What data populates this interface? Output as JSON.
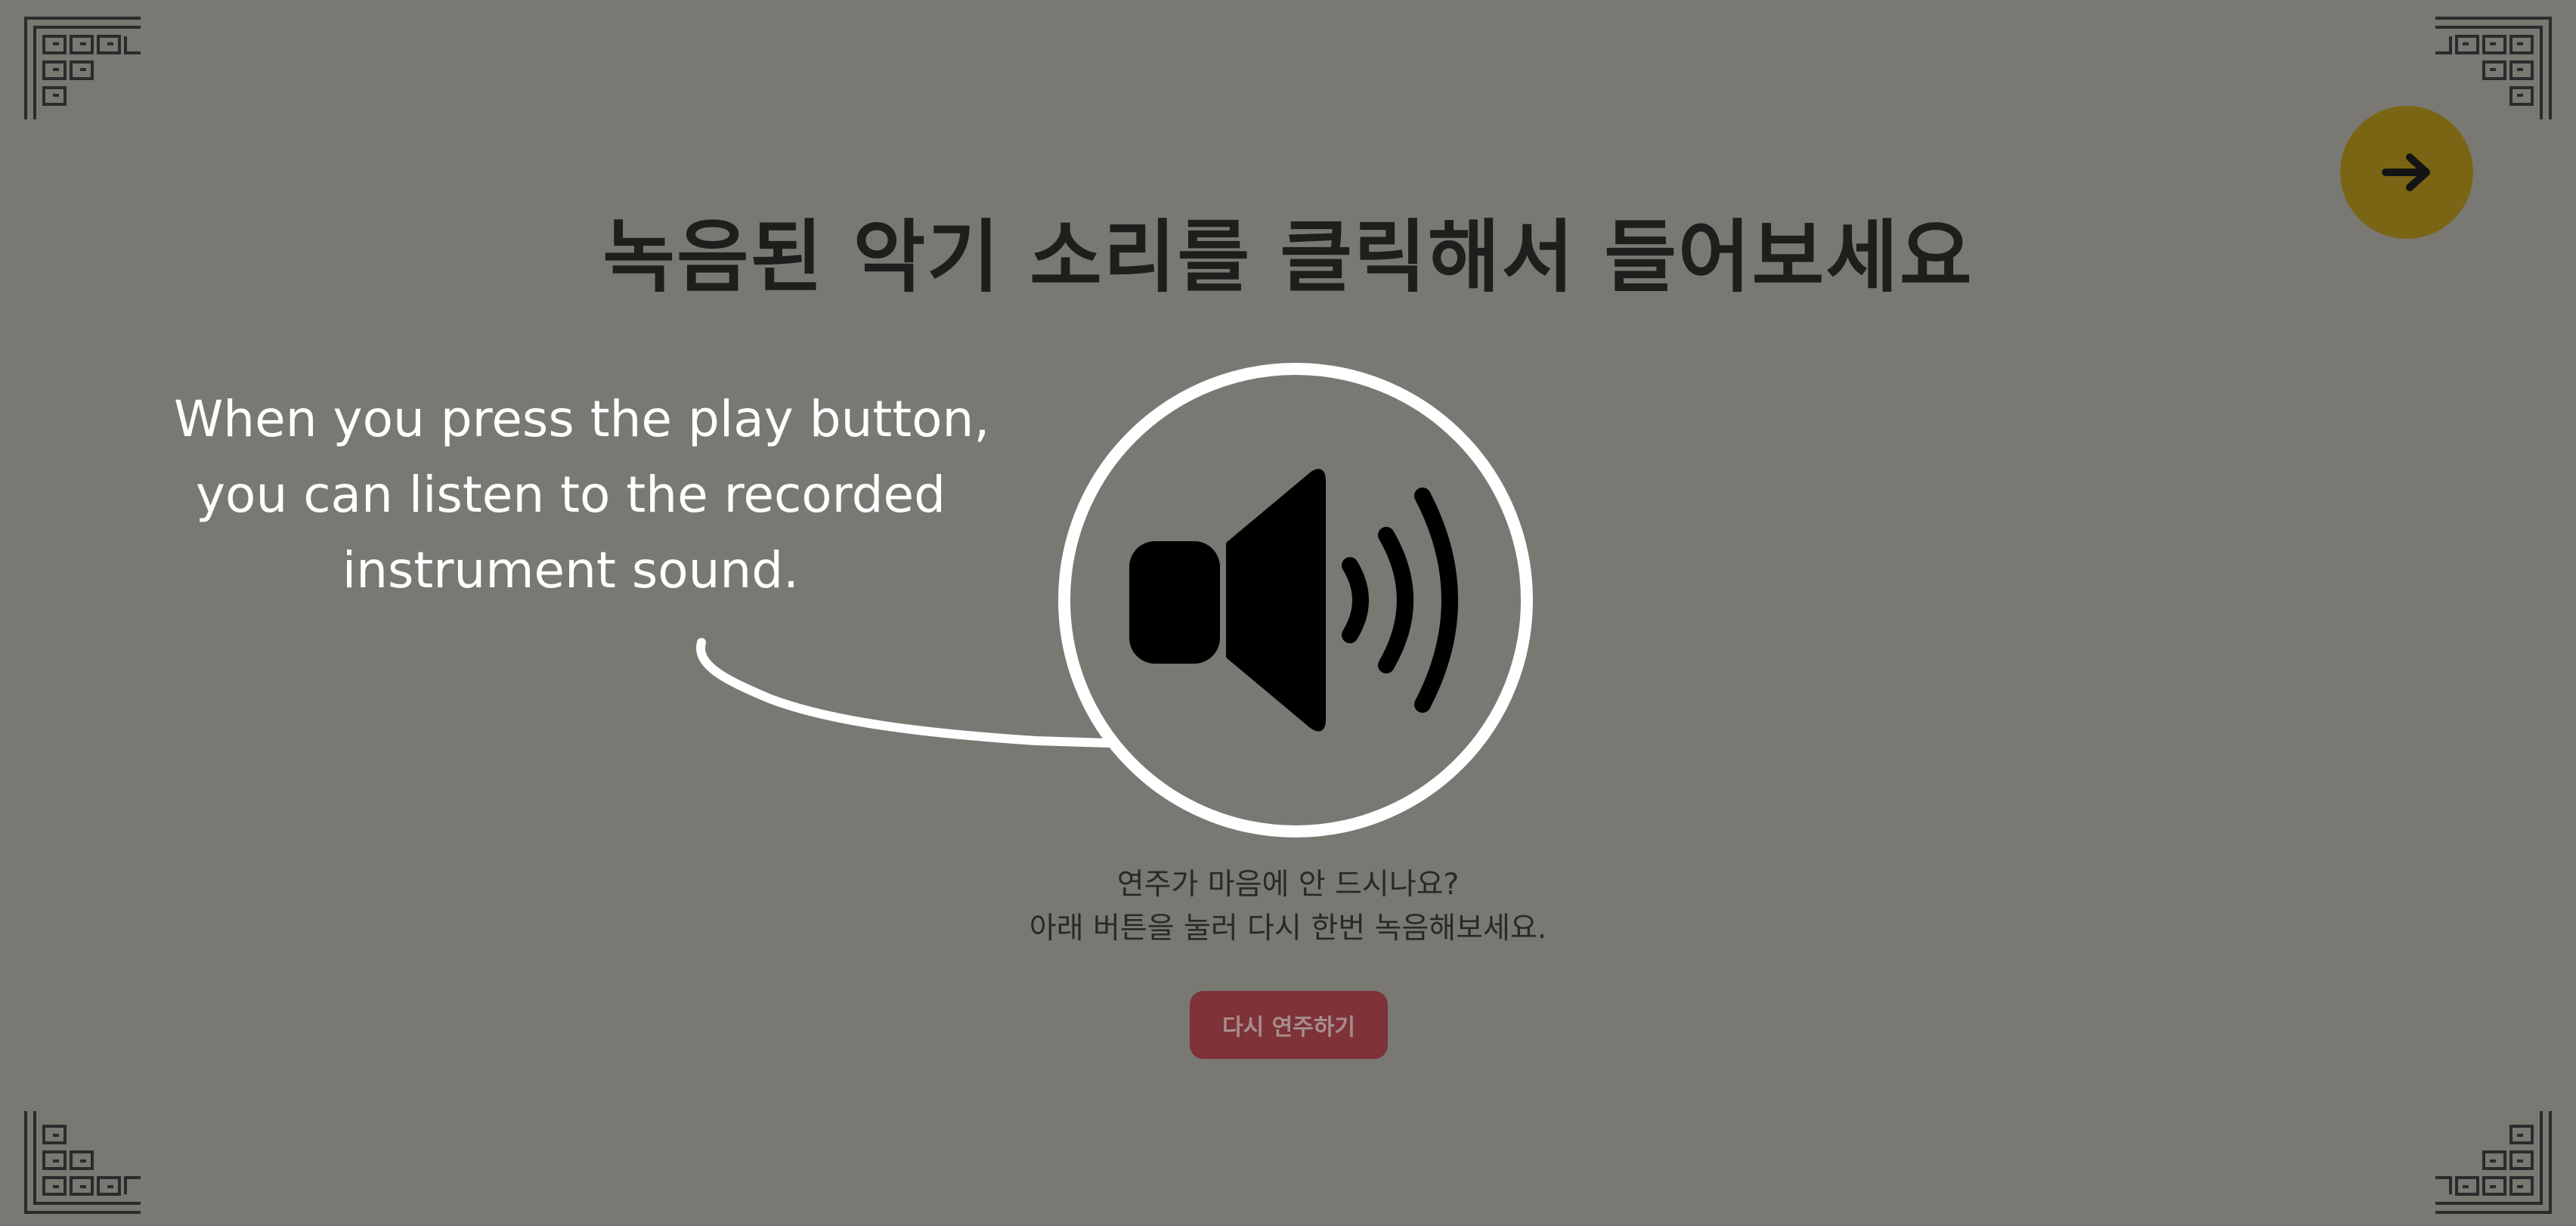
{
  "title": "녹음된 악기 소리를 클릭해서 들어보세요",
  "hint": {
    "line1": "When you press the play button,",
    "line2": "you can listen to the recorded",
    "line3": "instrument sound."
  },
  "message": {
    "line1": "연주가 마음에 안 드시나요?",
    "line2": "아래 버튼을 눌러 다시 한번 녹음해보세요."
  },
  "retry_button": {
    "label": "다시 연주하기"
  },
  "icons": {
    "next": "arrow-right-icon",
    "speaker": "speaker-volume-icon",
    "corner": "lattice-ornament-icon"
  },
  "colors": {
    "background": "#7a7873",
    "next_button": "#7a6514",
    "retry_button": "#7d3337",
    "title": "#1f1e1c",
    "hint": "#ffffff"
  }
}
